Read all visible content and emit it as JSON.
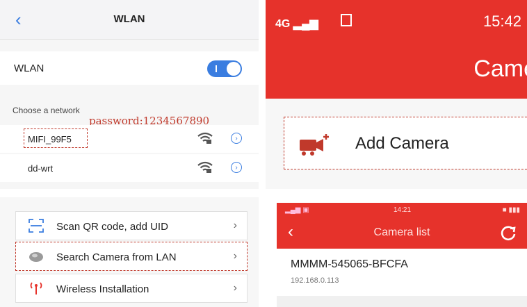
{
  "wlan_screen": {
    "title": "WLAN",
    "wlan_label": "WLAN",
    "wlan_enabled": true,
    "choose_label": "Choose a network",
    "networks": [
      {
        "name": "MIFI_99F5"
      },
      {
        "name": "dd-wrt"
      }
    ],
    "password_note": "password:1234567890",
    "accent_color": "#3a7de0",
    "annotation_color": "#c0392b"
  },
  "add_camera_screen": {
    "carrier": "4G",
    "time": "15:42",
    "title": "Came",
    "add_label": "Add Camera",
    "brand_color": "#e6322b"
  },
  "options_screen": {
    "items": [
      {
        "label": "Scan QR code, add UID",
        "icon": "qr-scan-icon"
      },
      {
        "label": "Search Camera from LAN",
        "icon": "lan-disc-icon"
      },
      {
        "label": "Wireless Installation",
        "icon": "wireless-antenna-icon"
      }
    ]
  },
  "camera_list_screen": {
    "time": "14:21",
    "title": "Camera list",
    "camera": {
      "name": "MMMM-545065-BFCFA",
      "ip": "192.168.0.113"
    }
  }
}
